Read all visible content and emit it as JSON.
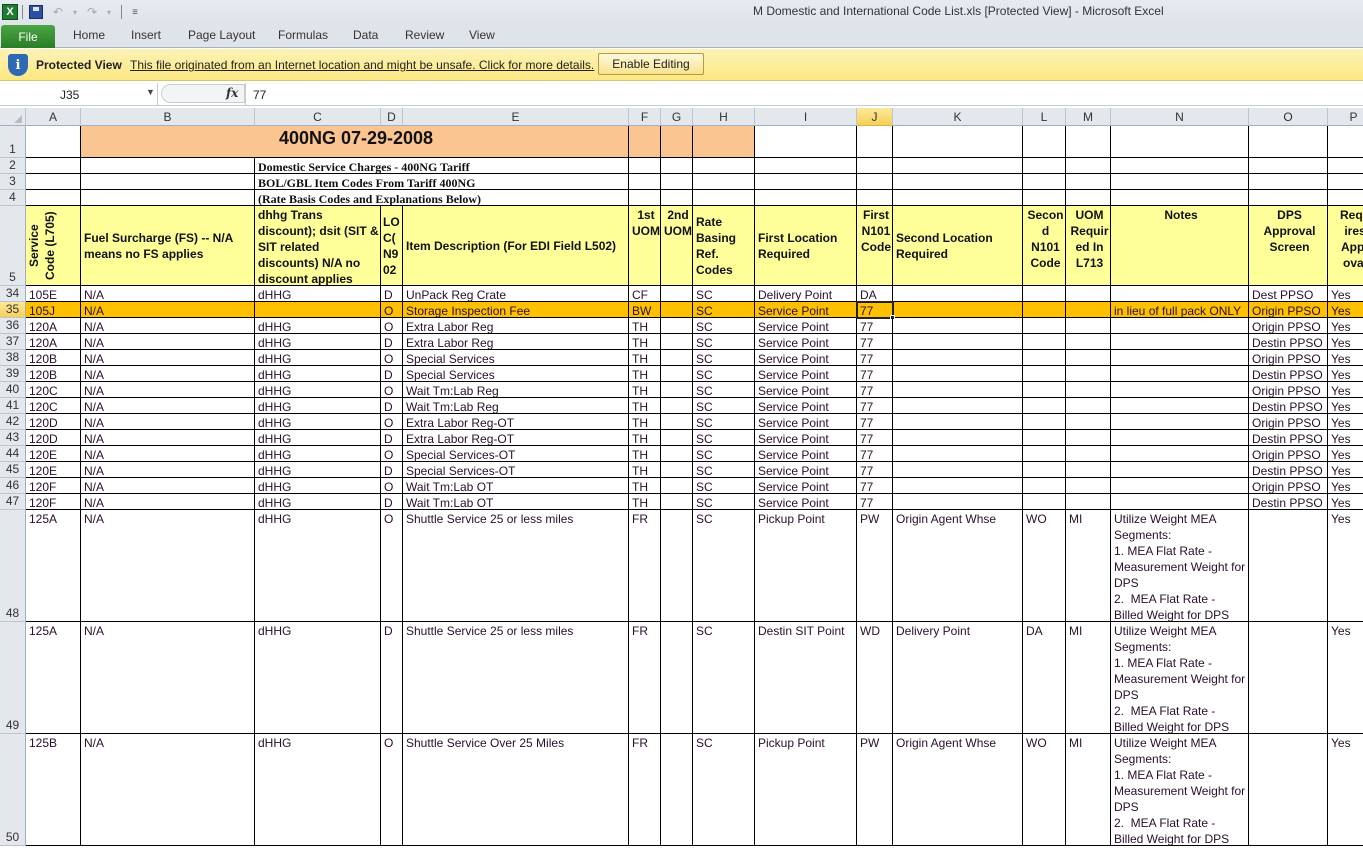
{
  "window": {
    "title": "M Domestic and International Code List.xls  [Protected View]  -  Microsoft Excel",
    "qat_icons": [
      "excel-logo-icon",
      "save-icon",
      "undo-icon",
      "redo-icon",
      "customize-qat-icon"
    ]
  },
  "ribbon": {
    "tabs": [
      "File",
      "Home",
      "Insert",
      "Page Layout",
      "Formulas",
      "Data",
      "Review",
      "View"
    ]
  },
  "protected_view": {
    "title": "Protected View",
    "message": "This file originated from an Internet location and might be unsafe. Click for more details.",
    "button": "Enable Editing"
  },
  "formula_bar": {
    "name_box": "J35",
    "fx": "fx",
    "value": "77"
  },
  "sheet": {
    "columns": [
      "A",
      "B",
      "C",
      "D",
      "E",
      "F",
      "G",
      "H",
      "I",
      "J",
      "K",
      "L",
      "M",
      "N",
      "O",
      "P"
    ],
    "selected_column": "J",
    "selected_row": "35",
    "title": "400NG 07-29-2008",
    "subtitle_lines": [
      "Domestic Service Charges - 400NG Tariff",
      "BOL/GBL Item Codes From Tariff 400NG",
      "(Rate Basis Codes and Explanations Below)"
    ],
    "headers": [
      "Service Code (L705)",
      "Fuel Surcharge (FS) --  N/A means  no FS applies",
      "dhhg  Trans discount); dsit (SIT & SIT related discounts) N/A no discount applies",
      "LO C( N9 02",
      "Item Description (For EDI Field L502)",
      "1st UOM",
      "2nd UOM",
      "Rate Basing Ref. Codes",
      "First Location Required",
      "First N101 Code",
      "Second Location Required",
      "Secon d N101 Code",
      "UOM Requir ed In L713",
      "Notes",
      "DPS Approval Screen",
      "Requ ires Appr oval"
    ],
    "header_row_labels": [
      "1",
      "2",
      "3",
      "4",
      "5"
    ],
    "rows": [
      {
        "row": "34",
        "cells": [
          "105E",
          "N/A",
          "dHHG",
          "D",
          "UnPack Reg Crate",
          "CF",
          "",
          "SC",
          "Delivery Point",
          "DA",
          "",
          "",
          "",
          "",
          "Dest PPSO",
          "Yes"
        ]
      },
      {
        "row": "35",
        "cells": [
          "105J",
          "N/A",
          "",
          "O",
          "Storage Inspection Fee",
          "BW",
          "",
          "SC",
          "Service Point",
          "77",
          "",
          "",
          "",
          "in lieu of full pack ONLY",
          "Origin PPSO",
          "Yes"
        ],
        "highlight": true
      },
      {
        "row": "36",
        "cells": [
          "120A",
          "N/A",
          "dHHG",
          "O",
          "Extra Labor Reg",
          "TH",
          "",
          "SC",
          "Service Point",
          "77",
          "",
          "",
          "",
          "",
          "Origin PPSO",
          "Yes"
        ]
      },
      {
        "row": "37",
        "cells": [
          "120A",
          "N/A",
          "dHHG",
          "D",
          "Extra Labor Reg",
          "TH",
          "",
          "SC",
          "Service Point",
          "77",
          "",
          "",
          "",
          "",
          "Destin PPSO",
          "Yes"
        ]
      },
      {
        "row": "38",
        "cells": [
          "120B",
          "N/A",
          "dHHG",
          "O",
          "Special Services",
          "TH",
          "",
          "SC",
          "Service Point",
          "77",
          "",
          "",
          "",
          "",
          "Origin PPSO",
          "Yes"
        ]
      },
      {
        "row": "39",
        "cells": [
          "120B",
          "N/A",
          "dHHG",
          "D",
          "Special Services",
          "TH",
          "",
          "SC",
          "Service Point",
          "77",
          "",
          "",
          "",
          "",
          "Destin PPSO",
          "Yes"
        ]
      },
      {
        "row": "40",
        "cells": [
          "120C",
          "N/A",
          "dHHG",
          "O",
          "Wait Tm:Lab Reg",
          "TH",
          "",
          "SC",
          "Service Point",
          "77",
          "",
          "",
          "",
          "",
          "Origin PPSO",
          "Yes"
        ]
      },
      {
        "row": "41",
        "cells": [
          "120C",
          "N/A",
          "dHHG",
          "D",
          "Wait Tm:Lab Reg",
          "TH",
          "",
          "SC",
          "Service Point",
          "77",
          "",
          "",
          "",
          "",
          "Destin PPSO",
          "Yes"
        ]
      },
      {
        "row": "42",
        "cells": [
          "120D",
          "N/A",
          "dHHG",
          "O",
          "Extra Labor Reg-OT",
          "TH",
          "",
          "SC",
          "Service Point",
          "77",
          "",
          "",
          "",
          "",
          "Origin PPSO",
          "Yes"
        ]
      },
      {
        "row": "43",
        "cells": [
          "120D",
          "N/A",
          "dHHG",
          "D",
          "Extra Labor Reg-OT",
          "TH",
          "",
          "SC",
          "Service Point",
          "77",
          "",
          "",
          "",
          "",
          "Destin PPSO",
          "Yes"
        ]
      },
      {
        "row": "44",
        "cells": [
          "120E",
          "N/A",
          "dHHG",
          "O",
          "Special Services-OT",
          "TH",
          "",
          "SC",
          "Service Point",
          "77",
          "",
          "",
          "",
          "",
          "Origin PPSO",
          "Yes"
        ]
      },
      {
        "row": "45",
        "cells": [
          "120E",
          "N/A",
          "dHHG",
          "D",
          "Special Services-OT",
          "TH",
          "",
          "SC",
          "Service Point",
          "77",
          "",
          "",
          "",
          "",
          "Destin PPSO",
          "Yes"
        ]
      },
      {
        "row": "46",
        "cells": [
          "120F",
          "N/A",
          "dHHG",
          "O",
          "Wait Tm:Lab OT",
          "TH",
          "",
          "SC",
          "Service Point",
          "77",
          "",
          "",
          "",
          "",
          "Origin PPSO",
          "Yes"
        ]
      },
      {
        "row": "47",
        "cells": [
          "120F",
          "N/A",
          "dHHG",
          "D",
          "Wait Tm:Lab OT",
          "TH",
          "",
          "SC",
          "Service Point",
          "77",
          "",
          "",
          "",
          "",
          "Destin PPSO",
          "Yes"
        ]
      },
      {
        "row": "48",
        "tall": true,
        "cells": [
          "125A",
          "N/A",
          "dHHG",
          "O",
          "Shuttle Service 25 or less miles",
          "FR",
          "",
          "SC",
          "Pickup Point",
          "PW",
          "Origin Agent Whse",
          "WO",
          "MI",
          "Utilize Weight MEA Segments:\n1. MEA Flat Rate - Measurement Weight for DPS\n2.  MEA Flat Rate - Billed Weight for DPS",
          "",
          "Yes"
        ]
      },
      {
        "row": "49",
        "tall": true,
        "cells": [
          "125A",
          "N/A",
          "dHHG",
          "D",
          "Shuttle Service 25 or less miles",
          "FR",
          "",
          "SC",
          "Destin SIT Point",
          "WD",
          "Delivery Point",
          "DA",
          "MI",
          "Utilize Weight MEA Segments:\n1. MEA Flat Rate - Measurement Weight for DPS\n2.  MEA Flat Rate - Billed Weight for DPS",
          "",
          "Yes"
        ]
      },
      {
        "row": "50",
        "tall": true,
        "cells": [
          "125B",
          "N/A",
          "dHHG",
          "O",
          "Shuttle Service Over 25 Miles",
          "FR",
          "",
          "SC",
          "Pickup Point",
          "PW",
          "Origin Agent Whse",
          "WO",
          "MI",
          "Utilize Weight MEA Segments:\n1. MEA Flat Rate - Measurement Weight for DPS\n2.  MEA Flat Rate - Billed Weight for DPS",
          "",
          "Yes"
        ]
      }
    ]
  },
  "colors": {
    "header_fill": "#ffff99",
    "title_fill": "#fbc592",
    "highlight_row": "#ffc000",
    "file_tab": "#2a7d28",
    "protected_bar": "#fbe881"
  }
}
